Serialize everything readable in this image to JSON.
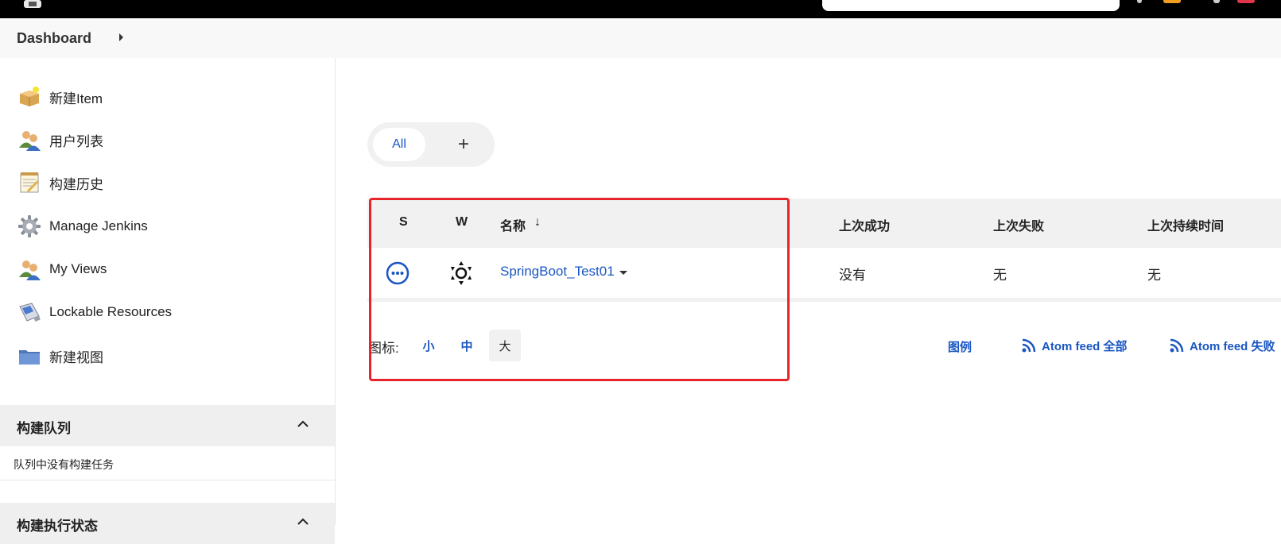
{
  "breadcrumb": {
    "root": "Dashboard"
  },
  "sidebar": {
    "items": [
      {
        "label": "新建Item",
        "icon": "new-item-icon"
      },
      {
        "label": "用户列表",
        "icon": "users-icon"
      },
      {
        "label": "构建历史",
        "icon": "notepad-icon"
      },
      {
        "label": "Manage Jenkins",
        "icon": "gear-icon"
      },
      {
        "label": "My Views",
        "icon": "users-icon"
      },
      {
        "label": "Lockable Resources",
        "icon": "usb-drive-icon"
      },
      {
        "label": "新建视图",
        "icon": "folder-icon"
      }
    ],
    "build_queue": {
      "title": "构建队列",
      "empty_text": "队列中没有构建任务"
    },
    "executor_status": {
      "title": "构建执行状态"
    }
  },
  "tabs": {
    "all": "All",
    "add": "+"
  },
  "table": {
    "headers": {
      "s": "S",
      "w": "W",
      "name": "名称",
      "sort": "↓",
      "last_success": "上次成功",
      "last_failure": "上次失败",
      "last_duration": "上次持续时间"
    },
    "rows": [
      {
        "status_icon": "not-built-icon",
        "weather_icon": "sunny-icon",
        "name": "SpringBoot_Test01",
        "last_success": "没有",
        "last_failure": "无",
        "last_duration": "无"
      }
    ]
  },
  "footer": {
    "icon_label": "图标:",
    "sizes": [
      "小",
      "中",
      "大"
    ],
    "legend": "图例",
    "feed_all": "Atom feed 全部",
    "feed_failures": "Atom feed 失败"
  },
  "colors": {
    "link": "#1a56c2",
    "highlight": "#e8242b",
    "topbar": "#000000"
  }
}
